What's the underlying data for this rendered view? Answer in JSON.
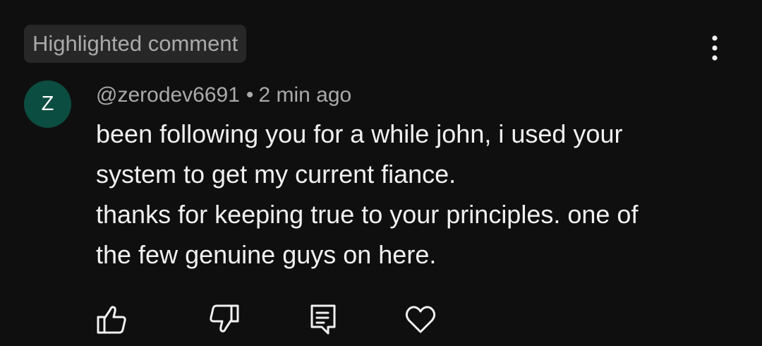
{
  "badge": "Highlighted comment",
  "author": {
    "avatar_letter": "Z",
    "avatar_color": "#0b4d40",
    "handle": "@zerodev6691",
    "separator": "•",
    "time": "2 min ago"
  },
  "comment": {
    "line1": "been following you for a while john, i used your",
    "line2": "system to get my current fiance.",
    "line3": "thanks for keeping true to your principles. one of",
    "line4": "the few genuine guys on here."
  },
  "actions": [
    {
      "icon": "thumbs-up-icon"
    },
    {
      "icon": "thumbs-down-icon"
    },
    {
      "icon": "reply-icon"
    },
    {
      "icon": "heart-icon"
    }
  ],
  "colors": {
    "background": "#0f0f0f",
    "text": "#f1f1f1",
    "secondary_text": "#aaaaaa",
    "badge_background": "#272727"
  }
}
